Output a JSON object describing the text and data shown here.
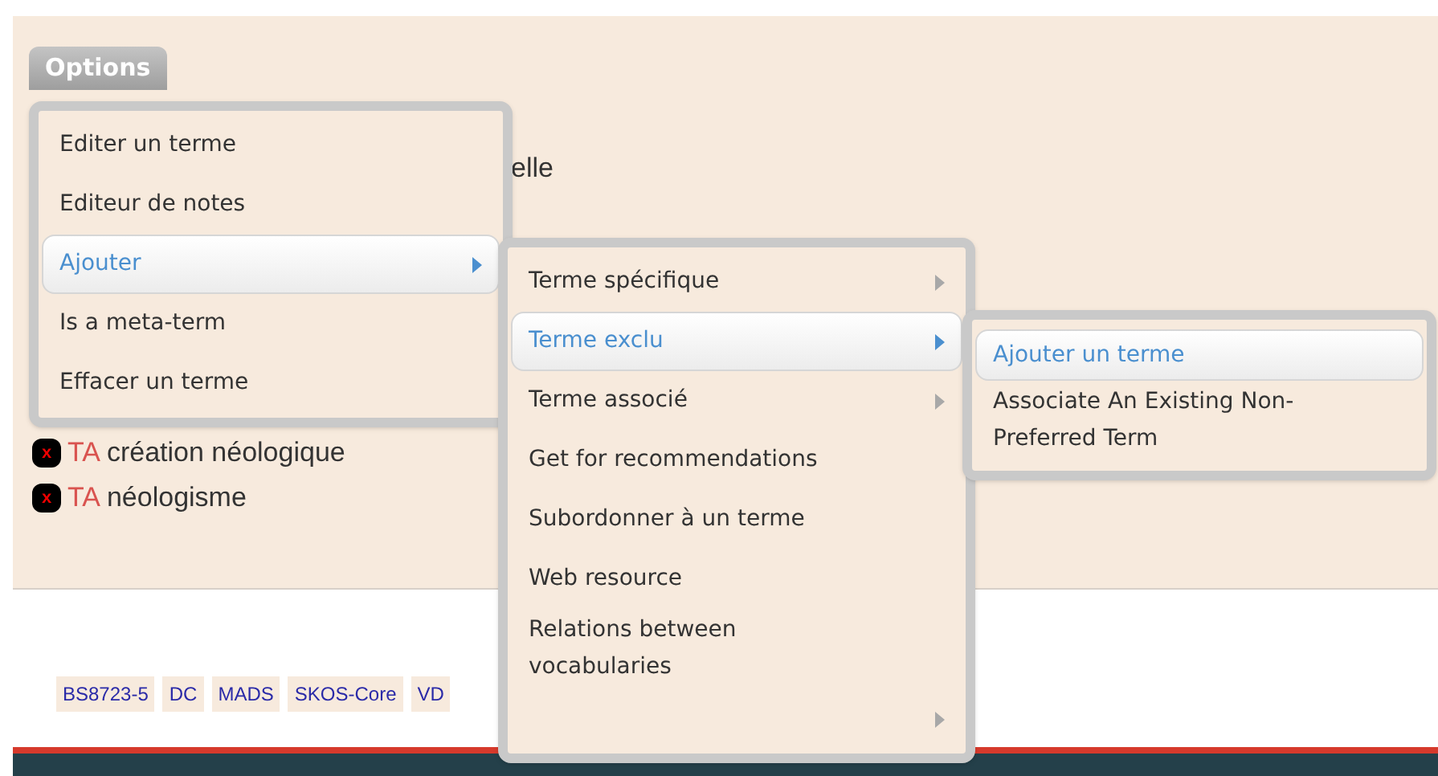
{
  "options_button": {
    "label": "Options"
  },
  "background_text": "elle",
  "terms": [
    {
      "badge": "x",
      "prefix": "TA",
      "label": "création néologique"
    },
    {
      "badge": "x",
      "prefix": "TA",
      "label": "néologisme"
    }
  ],
  "tags": [
    "BS8723-5",
    "DC",
    "MADS",
    "SKOS-Core",
    "VD"
  ],
  "menu": {
    "items": [
      {
        "label": "Editer un terme",
        "selected": false,
        "has_submenu": false
      },
      {
        "label": "Editeur de notes",
        "selected": false,
        "has_submenu": false
      },
      {
        "label": "Ajouter",
        "selected": true,
        "has_submenu": true
      },
      {
        "label": "Is a meta-term",
        "selected": false,
        "has_submenu": false
      },
      {
        "label": "Effacer un terme",
        "selected": false,
        "has_submenu": false
      }
    ]
  },
  "submenu": {
    "items": [
      {
        "label": "Terme spécifique",
        "selected": false,
        "has_submenu": true
      },
      {
        "label": "Terme exclu",
        "selected": true,
        "has_submenu": true
      },
      {
        "label": "Terme associé",
        "selected": false,
        "has_submenu": true
      },
      {
        "label": "Get for recommendations",
        "selected": false,
        "has_submenu": false
      },
      {
        "label": "Subordonner à un terme",
        "selected": false,
        "has_submenu": false
      },
      {
        "label": "Web resource",
        "selected": false,
        "has_submenu": false
      },
      {
        "label": "Relations between vocabularies",
        "selected": false,
        "has_submenu": false
      },
      {
        "selected": false,
        "has_submenu": true
      }
    ]
  },
  "submenu_2": {
    "items": [
      {
        "label": "Ajouter un terme",
        "selected": true,
        "has_submenu": false
      },
      {
        "label": "Associate An Existing Non-Preferred Term",
        "selected": false,
        "has_submenu": false
      }
    ]
  }
}
